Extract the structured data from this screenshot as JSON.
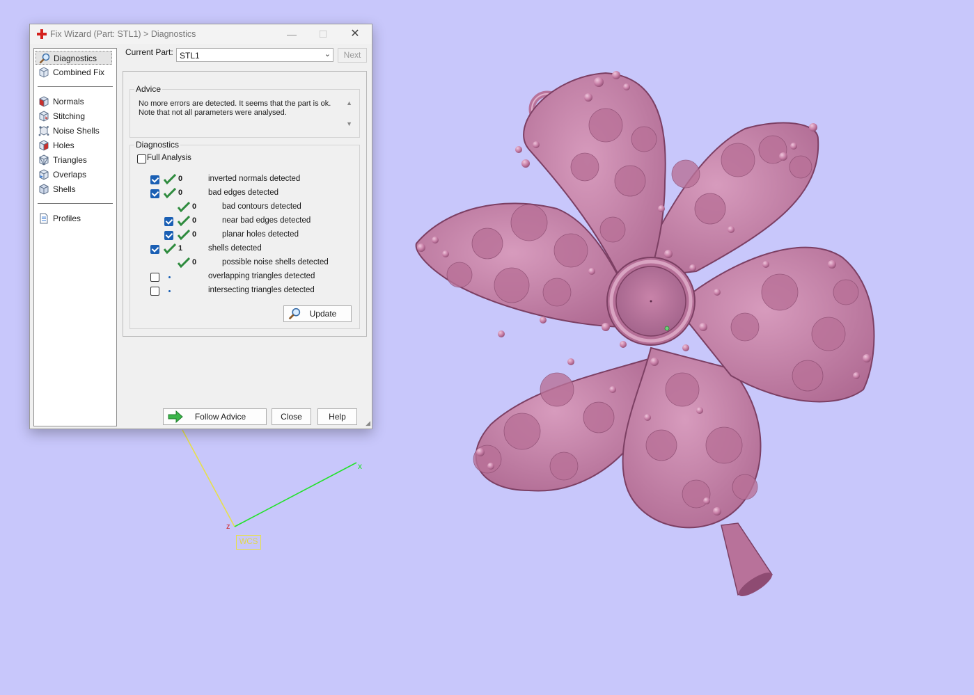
{
  "window": {
    "title": "Fix Wizard (Part: STL1) > Diagnostics",
    "minimize_glyph": "—",
    "maximize_glyph": "☐",
    "close_glyph": "✕",
    "icon": "red-cross-icon"
  },
  "sidebar": {
    "items": [
      {
        "label": "Diagnostics",
        "icon": "magnifier-icon",
        "selected": true
      },
      {
        "label": "Combined Fix",
        "icon": "cube-icon"
      },
      {
        "label": "Normals",
        "icon": "cube-red-icon"
      },
      {
        "label": "Stitching",
        "icon": "cube-stitch-icon"
      },
      {
        "label": "Noise Shells",
        "icon": "noise-shells-icon"
      },
      {
        "label": "Holes",
        "icon": "cube-holes-icon"
      },
      {
        "label": "Triangles",
        "icon": "cube-triangles-icon"
      },
      {
        "label": "Overlaps",
        "icon": "cube-overlaps-icon"
      },
      {
        "label": "Shells",
        "icon": "cube-shells-icon"
      },
      {
        "label": "Profiles",
        "icon": "document-icon"
      }
    ]
  },
  "current_part": {
    "label": "Current Part:",
    "value": "STL1",
    "next_label": "Next"
  },
  "advice": {
    "title": "Advice",
    "text": "No more errors are detected. It seems that the part is ok.\nNote that not all parameters were analysed."
  },
  "diagnostics": {
    "title": "Diagnostics",
    "full_analysis_label": "Full Analysis",
    "full_analysis_checked": false,
    "rows": [
      {
        "checkbox": true,
        "checked": true,
        "status": "ok",
        "count": "0",
        "label": "inverted normals detected",
        "indent": 0
      },
      {
        "checkbox": true,
        "checked": true,
        "status": "ok",
        "count": "0",
        "label": "bad edges detected",
        "indent": 0
      },
      {
        "checkbox": false,
        "checked": false,
        "status": "ok",
        "count": "0",
        "label": "bad contours detected",
        "indent": 1
      },
      {
        "checkbox": true,
        "checked": true,
        "status": "ok",
        "count": "0",
        "label": "near bad edges detected",
        "indent": 1
      },
      {
        "checkbox": true,
        "checked": true,
        "status": "ok",
        "count": "0",
        "label": "planar holes detected",
        "indent": 1
      },
      {
        "checkbox": true,
        "checked": true,
        "status": "ok",
        "count": "1",
        "label": "shells detected",
        "indent": 0
      },
      {
        "checkbox": false,
        "checked": false,
        "status": "ok",
        "count": "0",
        "label": "possible noise shells detected",
        "indent": 1
      },
      {
        "checkbox": true,
        "checked": false,
        "status": "pending",
        "count": "",
        "label": "overlapping triangles detected",
        "indent": 0
      },
      {
        "checkbox": true,
        "checked": false,
        "status": "pending",
        "count": "",
        "label": "intersecting triangles detected",
        "indent": 0
      }
    ],
    "update_label": "Update"
  },
  "buttons": {
    "follow_advice": "Follow Advice",
    "close": "Close",
    "help": "Help"
  },
  "viewport": {
    "axis_x_label": "x",
    "axis_z_label": "z",
    "wcs_label": "WCS",
    "model_color": "#c77fa8",
    "background_color": "#c8c7fb"
  }
}
